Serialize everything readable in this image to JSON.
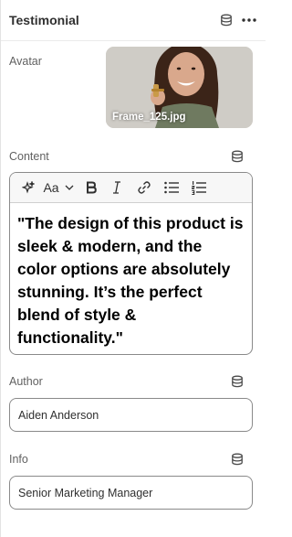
{
  "panel": {
    "title": "Testimonial"
  },
  "avatar": {
    "label": "Avatar",
    "filename": "Frame_125.jpg"
  },
  "content": {
    "label": "Content",
    "text": "\"The design of this product is sleek & modern, and the color options are absolutely stunning. It’s the perfect blend of style & functionality.\"",
    "toolbar": {
      "font_label": "Aa"
    }
  },
  "author": {
    "label": "Author",
    "value": "Aiden Anderson"
  },
  "info": {
    "label": "Info",
    "value": "Senior Marketing Manager"
  },
  "colors": {
    "border": "#8a8a8a",
    "text": "#303030",
    "muted": "#616161"
  }
}
